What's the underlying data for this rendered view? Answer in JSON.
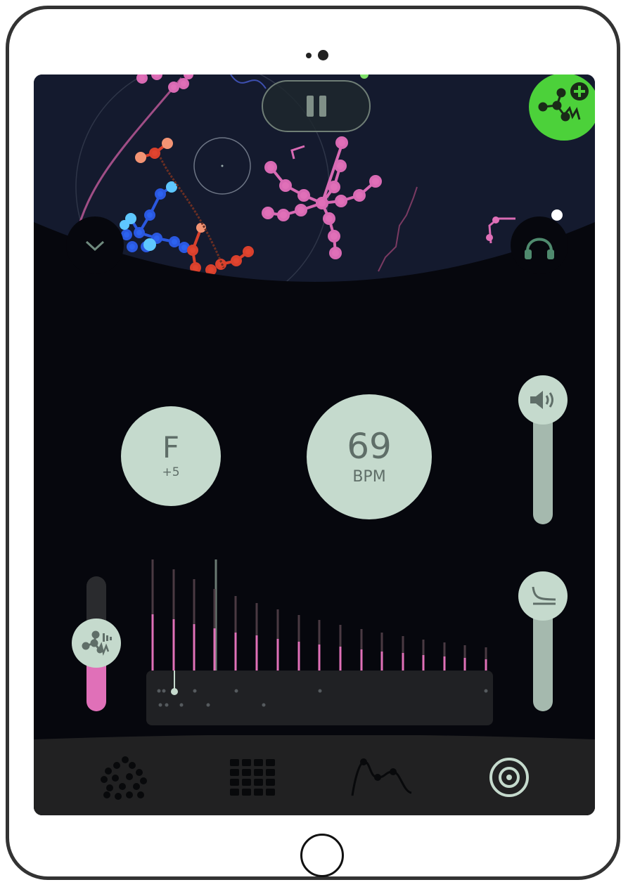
{
  "device": {
    "type": "tablet"
  },
  "visualizer": {
    "pause_icon": "pause-icon",
    "add_button_icon": "molecule-plus-icon",
    "add_button_color": "#4cd13a",
    "collapse_icon": "chevron-down-icon",
    "headphones_icon": "headphones-icon"
  },
  "controls": {
    "key": {
      "note": "F",
      "offset": "+5"
    },
    "tempo": {
      "value": "69",
      "unit": "BPM"
    },
    "volume_icon": "speaker-icon",
    "filter_icon": "lowpass-curve-icon",
    "density_icon": "molecule-waveform-icon",
    "density_level": 0.4,
    "accent_color": "#e070b8",
    "knob_color": "#c5dacd"
  },
  "tabs": [
    {
      "name": "molecules",
      "icon": "dots-cluster-icon",
      "active": false
    },
    {
      "name": "grid",
      "icon": "grid-icon",
      "active": false
    },
    {
      "name": "envelope",
      "icon": "curve-points-icon",
      "active": false
    },
    {
      "name": "target",
      "icon": "target-icon",
      "active": true
    }
  ]
}
